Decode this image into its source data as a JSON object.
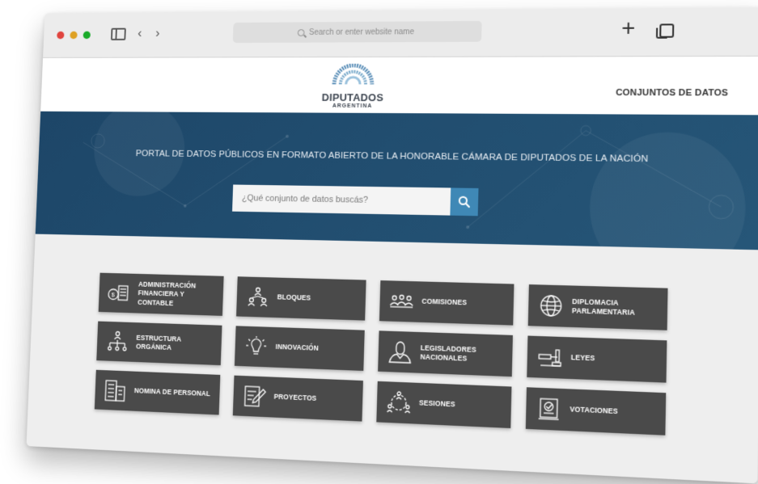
{
  "browser": {
    "address_placeholder": "Search or enter website name",
    "traffic_lights": [
      "#e0443e",
      "#dea123",
      "#1aab29"
    ]
  },
  "site": {
    "logo_title": "DIPUTADOS",
    "logo_subtitle": "ARGENTINA",
    "nav_link": "CONJUNTOS DE DATOS",
    "hero_title": "PORTAL DE DATOS PÚBLICOS EN FORMATO ABIERTO DE LA HONORABLE CÁMARA DE DIPUTADOS DE LA NACIÓN",
    "search_placeholder": "¿Qué conjunto de datos buscás?",
    "hero_color": "#1f4a6c",
    "accent": "#3f88b6"
  },
  "categories": [
    {
      "label": "ADMINISTRACIÓN FINANCIERA Y CONTABLE",
      "icon": "finance-icon"
    },
    {
      "label": "BLOQUES",
      "icon": "blocks-icon"
    },
    {
      "label": "COMISIONES",
      "icon": "committees-icon"
    },
    {
      "label": "DIPLOMACIA PARLAMENTARIA",
      "icon": "globe-icon"
    },
    {
      "label": "ESTRUCTURA ORGÁNICA",
      "icon": "org-chart-icon"
    },
    {
      "label": "INNOVACIÓN",
      "icon": "lightbulb-icon"
    },
    {
      "label": "LEGISLADORES NACIONALES",
      "icon": "legislator-icon"
    },
    {
      "label": "LEYES",
      "icon": "gavel-icon"
    },
    {
      "label": "NOMINA DE PERSONAL",
      "icon": "building-icon"
    },
    {
      "label": "PROYECTOS",
      "icon": "document-edit-icon"
    },
    {
      "label": "SESIONES",
      "icon": "session-icon"
    },
    {
      "label": "VOTACIONES",
      "icon": "ballot-icon"
    }
  ]
}
